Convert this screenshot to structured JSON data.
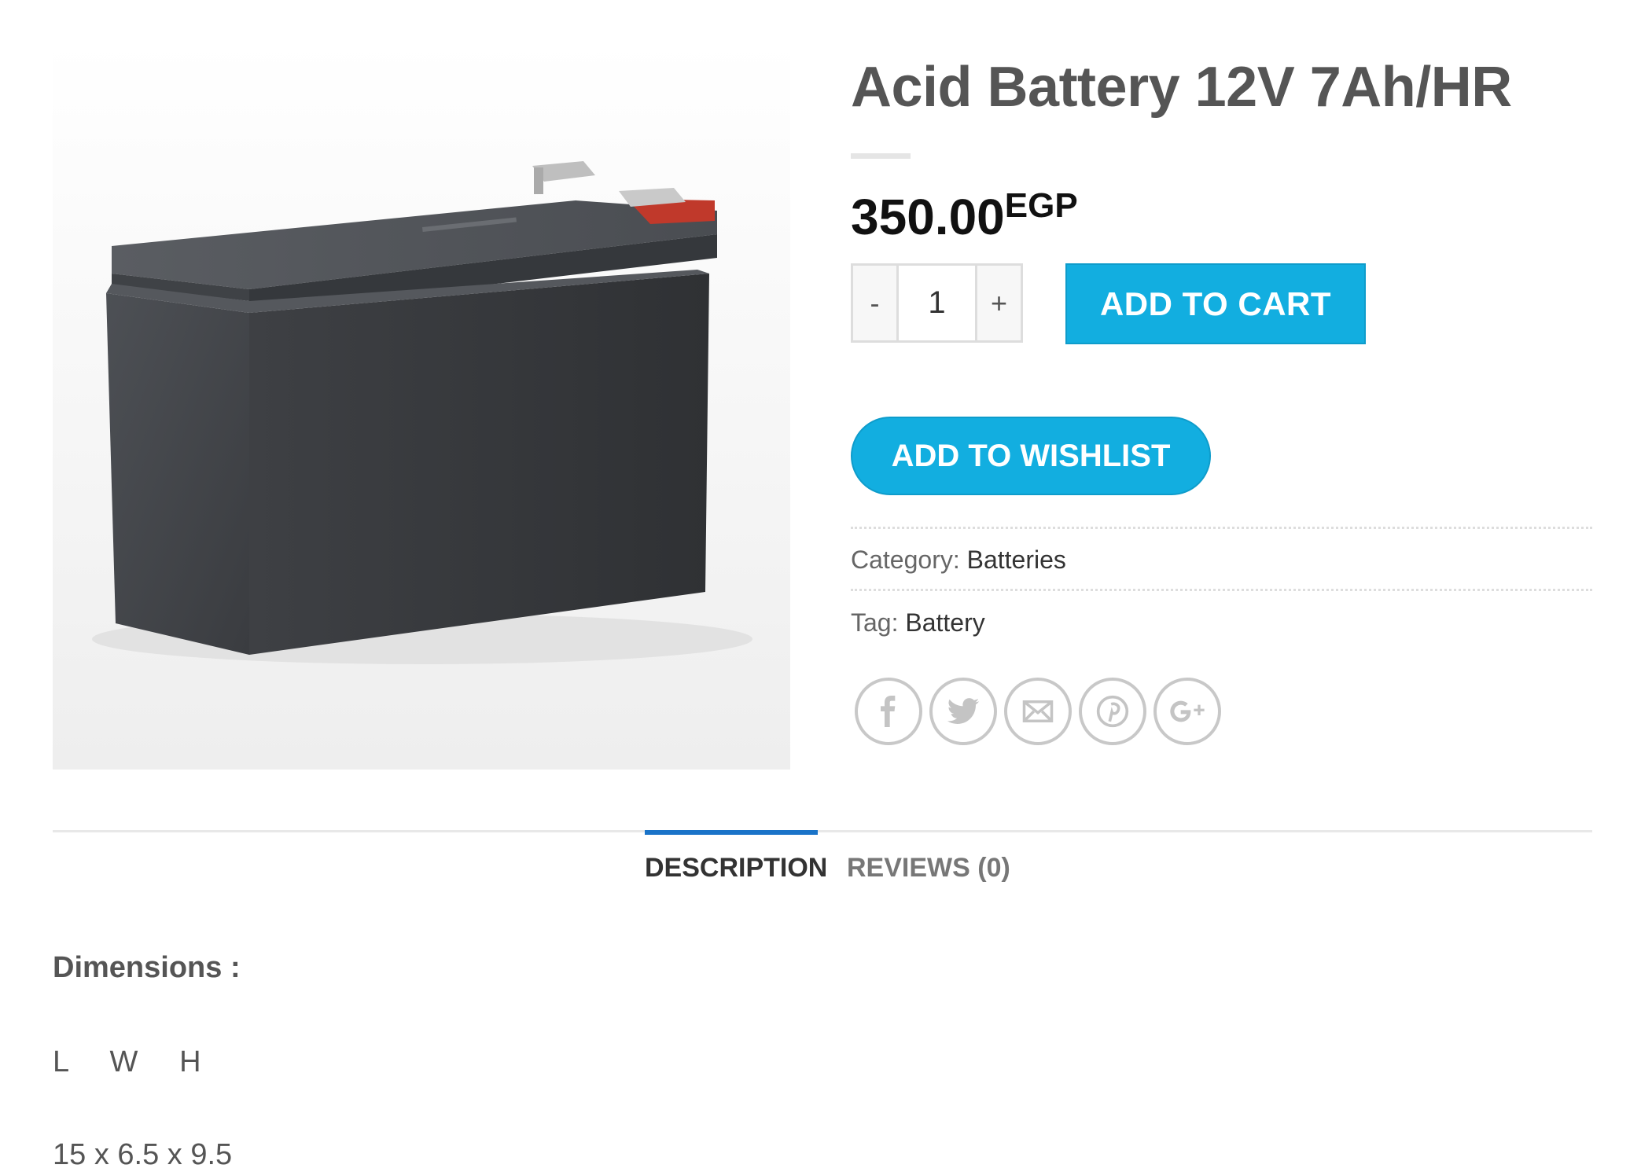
{
  "product": {
    "image_alt": "Acid battery product photo",
    "title": "Acid Battery 12V 7Ah/HR",
    "price_amount": "350.00",
    "price_currency": "EGP"
  },
  "quantity": {
    "minus_label": "-",
    "value": "1",
    "plus_label": "+"
  },
  "actions": {
    "add_to_cart": "ADD TO CART",
    "add_to_wishlist": "ADD TO WISHLIST"
  },
  "meta": {
    "category_label": "Category:",
    "category_value": "Batteries",
    "tag_label": "Tag:",
    "tag_value": "Battery"
  },
  "social": [
    {
      "icon": "facebook-icon"
    },
    {
      "icon": "twitter-icon"
    },
    {
      "icon": "email-icon"
    },
    {
      "icon": "pinterest-icon"
    },
    {
      "icon": "google-plus-icon"
    }
  ],
  "tabs": {
    "description": "DESCRIPTION",
    "reviews": "REVIEWS (0)"
  },
  "description": {
    "dimensions_title": "Dimensions  :",
    "axes": "L     W     H",
    "values": "15 x 6.5 x 9.5"
  },
  "colors": {
    "accent": "#12aee0",
    "tab_active": "#1a73c8"
  }
}
